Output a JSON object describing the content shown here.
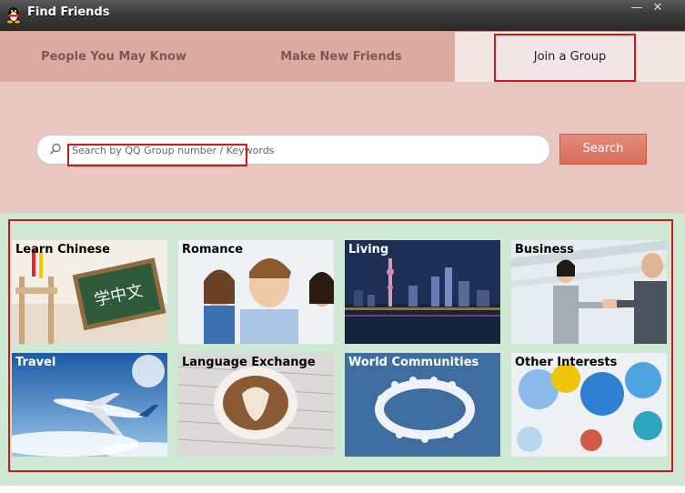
{
  "window": {
    "title": "Find Friends",
    "minimize_glyph": "—",
    "close_glyph": "✕"
  },
  "tabs": [
    {
      "label": "People You May Know"
    },
    {
      "label": "Make New Friends"
    },
    {
      "label": "Join a Group",
      "selected": true
    }
  ],
  "search": {
    "placeholder": "Search by QQ Group number / Keywords",
    "button_label": "Search"
  },
  "categories": [
    {
      "label": "Learn Chinese",
      "chalk_text": "学中文"
    },
    {
      "label": "Romance"
    },
    {
      "label": "Living"
    },
    {
      "label": "Business"
    },
    {
      "label": "Travel"
    },
    {
      "label": "Language Exchange"
    },
    {
      "label": "World Communities"
    },
    {
      "label": "Other Interests"
    }
  ],
  "colors": {
    "accent_red": "#d01818",
    "search_button": "#d66d5b",
    "grid_bg": "#cfe8d4"
  }
}
